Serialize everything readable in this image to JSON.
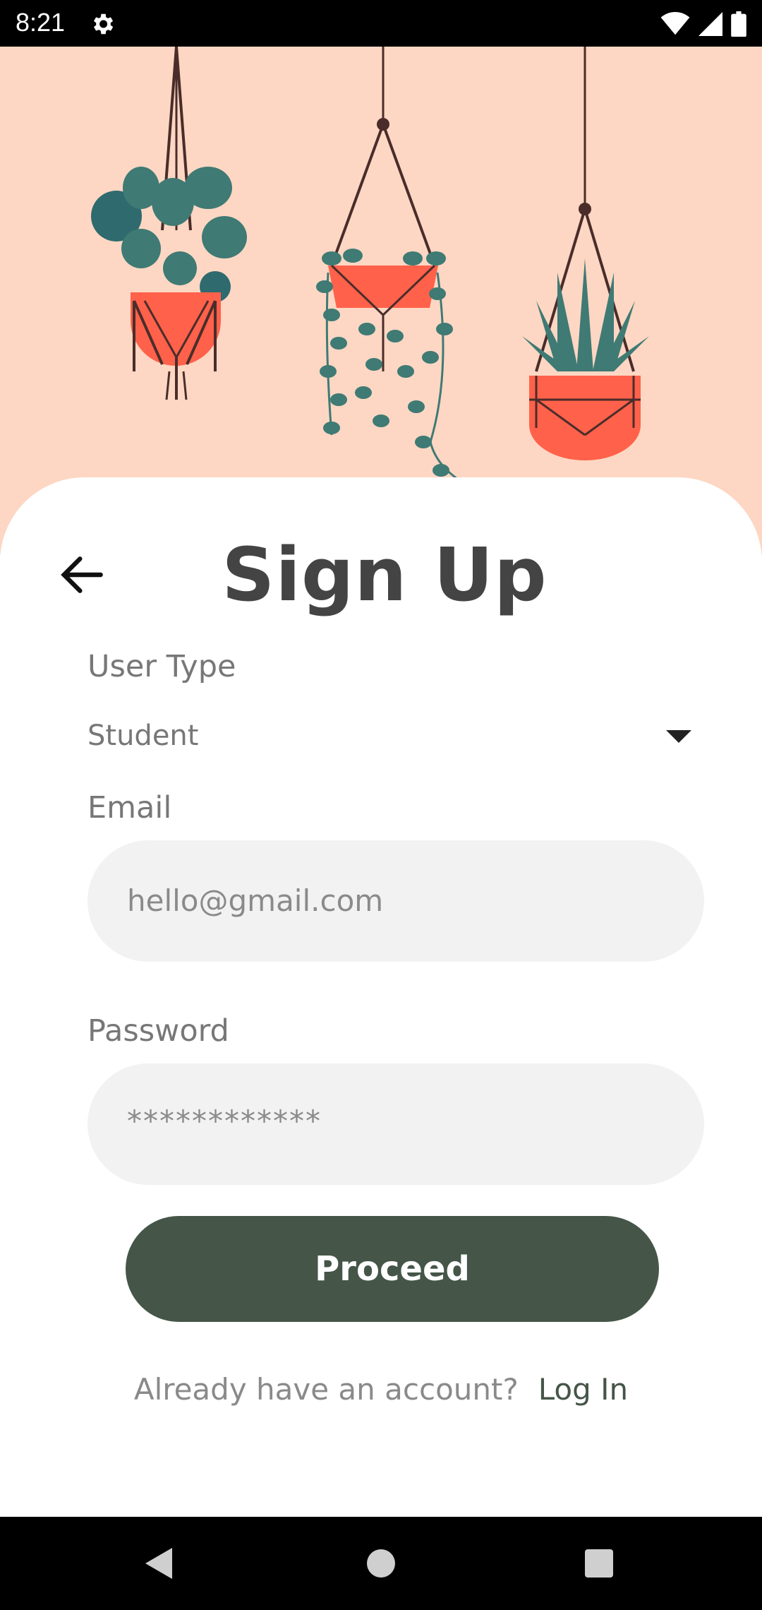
{
  "status_bar": {
    "time": "8:21"
  },
  "screen": {
    "title": "Sign Up"
  },
  "form": {
    "user_type": {
      "label": "User Type",
      "value": "Student"
    },
    "email": {
      "label": "Email",
      "placeholder": "hello@gmail.com"
    },
    "password": {
      "label": "Password",
      "placeholder": "************"
    },
    "proceed_label": "Proceed"
  },
  "footer": {
    "question": "Already have an account?",
    "login_label": "Log In"
  },
  "colors": {
    "hero_background": "#fdd7c3",
    "primary": "#455548",
    "pot": "#ff614a",
    "leaf": "#3f7a74"
  }
}
